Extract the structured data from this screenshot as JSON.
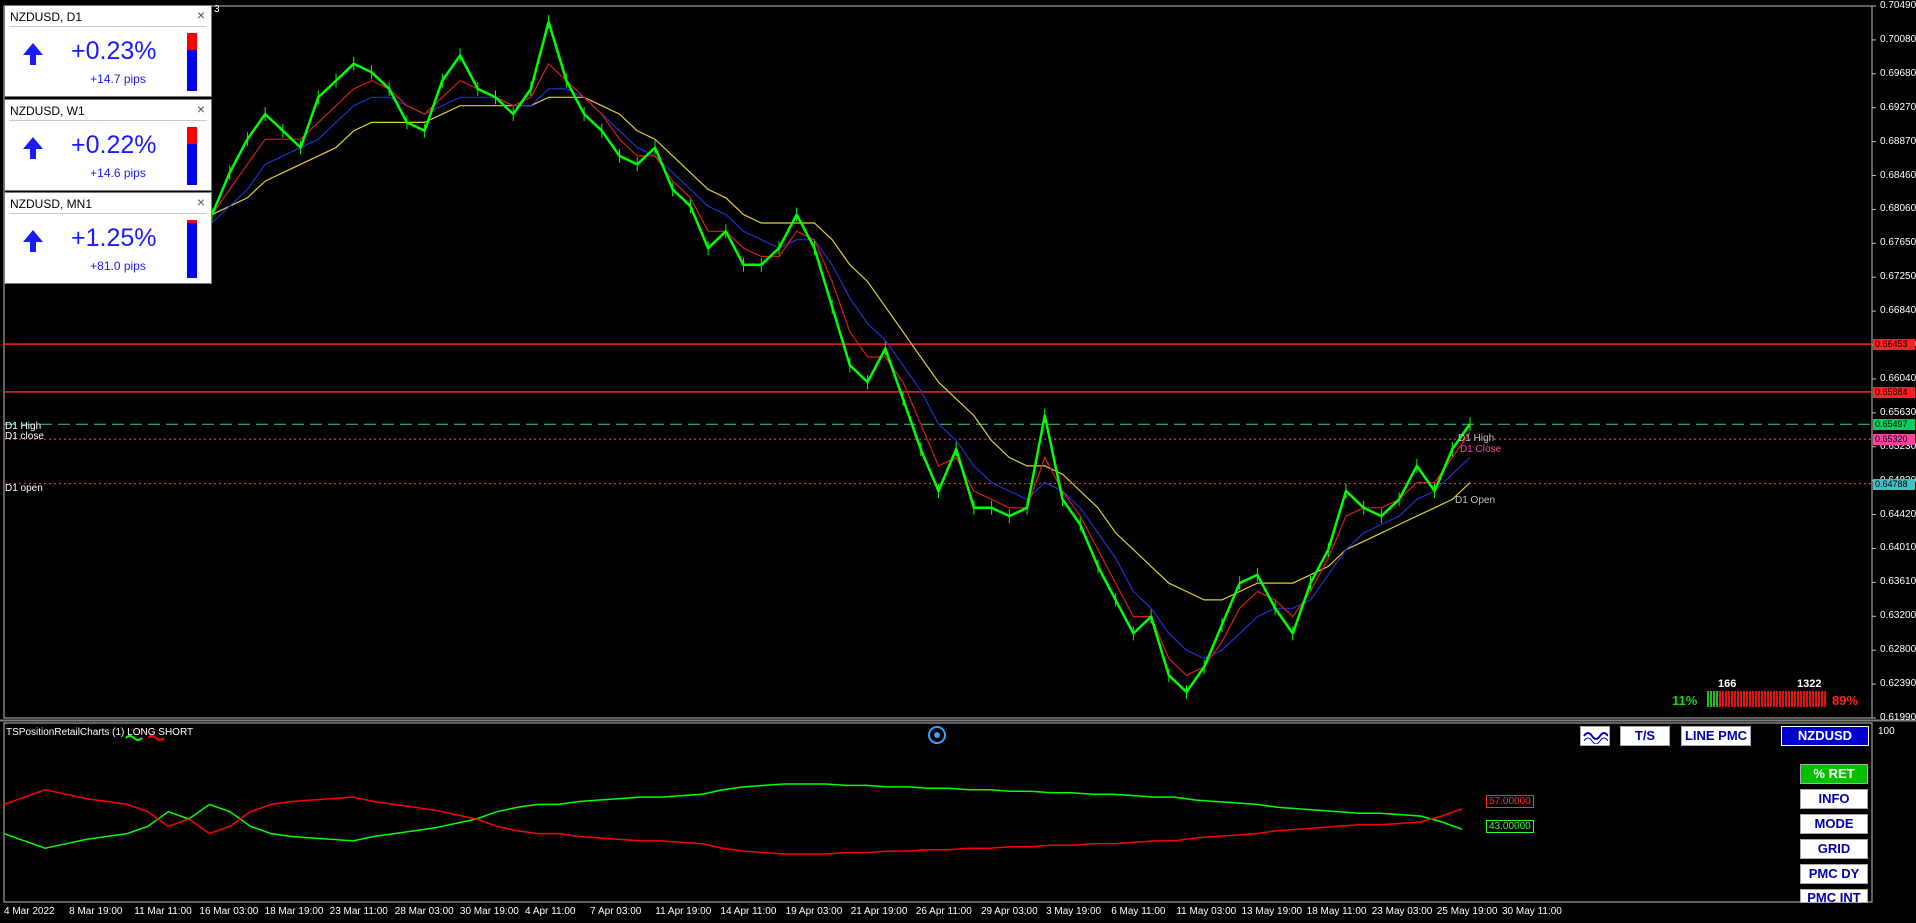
{
  "tickers": [
    {
      "title": "NZDUSD, D1",
      "change": "+0.23%",
      "pips": "+14.7 pips",
      "close": "×",
      "up_frac": 0.3
    },
    {
      "title": "NZDUSD, W1",
      "change": "+0.22%",
      "pips": "+14.6 pips",
      "close": "×",
      "up_frac": 0.3
    },
    {
      "title": "NZDUSD, MN1",
      "change": "+1.25%",
      "pips": "+81.0 pips",
      "close": "×",
      "up_frac": 0.05
    }
  ],
  "top_corner_label": "3",
  "y_axis": [
    "0.70490",
    "0.70080",
    "0.69680",
    "0.69270",
    "0.68870",
    "0.68460",
    "0.68060",
    "0.67650",
    "0.67250",
    "0.66840",
    "0.66440",
    "0.66040",
    "0.65630",
    "0.65230",
    "0.64830",
    "0.64420",
    "0.64010",
    "0.63610",
    "0.63200",
    "0.62800",
    "0.62390",
    "0.61990"
  ],
  "price_tags": [
    {
      "value": "0.66453",
      "color": "#ff2020"
    },
    {
      "value": "0.65884",
      "color": "#ff2020"
    },
    {
      "value": "0.65497",
      "color": "#00d060"
    },
    {
      "value": "0.65320",
      "color": "#ff40a0"
    },
    {
      "value": "0.64788",
      "color": "#40c0c0"
    }
  ],
  "left_labels": {
    "d1_high": "D1 High",
    "d1_close": "D1 close",
    "d1_open": "D1 open"
  },
  "right_labels": {
    "d1_high": "D1 High",
    "d1_close": "D1 Close",
    "d1_open": "D1 Open"
  },
  "sentiment": {
    "long_count": "166",
    "short_count": "1322",
    "long_pct": "11%",
    "short_pct": "89%",
    "long_frac": 0.11
  },
  "indicator": {
    "name": "TSPositionRetailCharts (1) LONG SHORT",
    "scale_top": "100",
    "short_value": "57.00000",
    "long_value": "43.00000",
    "colors": {
      "long": "#00ff00",
      "short": "#ff0000"
    }
  },
  "top_buttons": {
    "wave_icon": "wave-icon",
    "ts": "T/S",
    "line_pmc": "LINE PMC",
    "symbol": "NZDUSD"
  },
  "side_buttons": [
    "% RET",
    "INFO",
    "MODE",
    "GRID",
    "PMC DY",
    "PMC INT"
  ],
  "x_axis": [
    "4 Mar 2022",
    "8 Mar 19:00",
    "11 Mar 11:00",
    "16 Mar 03:00",
    "18 Mar 19:00",
    "23 Mar 11:00",
    "28 Mar 03:00",
    "30 Mar 19:00",
    "4 Apr 11:00",
    "7 Apr 03:00",
    "11 Apr 19:00",
    "14 Apr 11:00",
    "19 Apr 03:00",
    "21 Apr 19:00",
    "26 Apr 11:00",
    "29 Apr 03:00",
    "3 May 19:00",
    "6 May 11:00",
    "11 May 03:00",
    "13 May 19:00",
    "18 May 11:00",
    "23 May 03:00",
    "25 May 19:00",
    "30 May 11:00"
  ],
  "chart_data": {
    "type": "line",
    "symbol": "NZDUSD",
    "ylim": [
      0.6199,
      0.7049
    ],
    "price": [
      0.68,
      0.685,
      0.689,
      0.692,
      0.69,
      0.688,
      0.694,
      0.696,
      0.698,
      0.697,
      0.695,
      0.691,
      0.69,
      0.696,
      0.699,
      0.695,
      0.694,
      0.692,
      0.695,
      0.703,
      0.696,
      0.692,
      0.69,
      0.687,
      0.686,
      0.688,
      0.683,
      0.681,
      0.676,
      0.678,
      0.674,
      0.674,
      0.676,
      0.68,
      0.676,
      0.669,
      0.662,
      0.66,
      0.664,
      0.658,
      0.652,
      0.647,
      0.652,
      0.645,
      0.645,
      0.644,
      0.645,
      0.656,
      0.646,
      0.643,
      0.638,
      0.634,
      0.63,
      0.632,
      0.625,
      0.623,
      0.626,
      0.631,
      0.636,
      0.637,
      0.633,
      0.63,
      0.636,
      0.64,
      0.647,
      0.645,
      0.644,
      0.646,
      0.65,
      0.647,
      0.652,
      0.655
    ],
    "ma_fast": [
      0.68,
      0.683,
      0.686,
      0.689,
      0.689,
      0.689,
      0.691,
      0.693,
      0.695,
      0.696,
      0.695,
      0.693,
      0.692,
      0.694,
      0.696,
      0.695,
      0.694,
      0.693,
      0.694,
      0.698,
      0.696,
      0.694,
      0.692,
      0.689,
      0.687,
      0.687,
      0.684,
      0.682,
      0.678,
      0.678,
      0.676,
      0.675,
      0.675,
      0.678,
      0.677,
      0.672,
      0.666,
      0.663,
      0.663,
      0.66,
      0.655,
      0.65,
      0.651,
      0.647,
      0.646,
      0.645,
      0.645,
      0.651,
      0.647,
      0.644,
      0.64,
      0.636,
      0.632,
      0.632,
      0.627,
      0.625,
      0.626,
      0.629,
      0.633,
      0.635,
      0.634,
      0.632,
      0.635,
      0.639,
      0.644,
      0.645,
      0.645,
      0.646,
      0.648,
      0.648,
      0.651,
      0.654
    ],
    "ma_mid": [
      0.679,
      0.681,
      0.683,
      0.686,
      0.687,
      0.688,
      0.689,
      0.691,
      0.693,
      0.694,
      0.694,
      0.693,
      0.692,
      0.693,
      0.694,
      0.694,
      0.694,
      0.693,
      0.693,
      0.695,
      0.695,
      0.694,
      0.692,
      0.69,
      0.688,
      0.687,
      0.685,
      0.683,
      0.681,
      0.68,
      0.678,
      0.677,
      0.676,
      0.677,
      0.677,
      0.674,
      0.67,
      0.667,
      0.665,
      0.662,
      0.659,
      0.655,
      0.653,
      0.65,
      0.648,
      0.647,
      0.646,
      0.648,
      0.647,
      0.645,
      0.642,
      0.639,
      0.635,
      0.633,
      0.63,
      0.628,
      0.627,
      0.628,
      0.63,
      0.632,
      0.633,
      0.633,
      0.634,
      0.637,
      0.64,
      0.642,
      0.643,
      0.644,
      0.646,
      0.647,
      0.649,
      0.651
    ],
    "ma_slow": [
      0.68,
      0.681,
      0.682,
      0.684,
      0.685,
      0.686,
      0.687,
      0.688,
      0.69,
      0.691,
      0.691,
      0.691,
      0.691,
      0.692,
      0.693,
      0.693,
      0.693,
      0.693,
      0.693,
      0.694,
      0.694,
      0.694,
      0.693,
      0.692,
      0.69,
      0.689,
      0.687,
      0.685,
      0.683,
      0.682,
      0.68,
      0.679,
      0.679,
      0.679,
      0.679,
      0.677,
      0.674,
      0.672,
      0.669,
      0.666,
      0.663,
      0.66,
      0.658,
      0.656,
      0.653,
      0.651,
      0.65,
      0.65,
      0.649,
      0.647,
      0.645,
      0.642,
      0.64,
      0.638,
      0.636,
      0.635,
      0.634,
      0.634,
      0.635,
      0.636,
      0.636,
      0.636,
      0.637,
      0.638,
      0.64,
      0.641,
      0.642,
      0.643,
      0.644,
      0.645,
      0.646,
      0.648
    ],
    "levels": [
      {
        "value": 0.66453,
        "color": "#ff2020",
        "style": "solid"
      },
      {
        "value": 0.65884,
        "color": "#ff2020",
        "style": "solid"
      },
      {
        "value": 0.65497,
        "color": "#40d080",
        "style": "dashed"
      },
      {
        "value": 0.6532,
        "color": "#ff40a0",
        "style": "dotted"
      },
      {
        "value": 0.64788,
        "color": "#ff4040",
        "style": "dotted"
      }
    ],
    "long_pct": [
      40,
      35,
      30,
      33,
      36,
      38,
      40,
      45,
      55,
      50,
      60,
      55,
      45,
      40,
      38,
      37,
      36,
      35,
      38,
      40,
      42,
      44,
      47,
      50,
      55,
      58,
      60,
      60,
      62,
      63,
      64,
      65,
      65,
      66,
      67,
      70,
      72,
      73,
      74,
      74,
      74,
      73,
      73,
      72,
      72,
      71,
      71,
      70,
      70,
      69,
      69,
      68,
      68,
      67,
      67,
      66,
      65,
      65,
      63,
      62,
      61,
      60,
      58,
      57,
      56,
      55,
      54,
      54,
      53,
      52,
      48,
      43
    ],
    "short_pct": [
      60,
      65,
      70,
      67,
      64,
      62,
      60,
      55,
      45,
      50,
      40,
      45,
      55,
      60,
      62,
      63,
      64,
      65,
      62,
      60,
      58,
      56,
      53,
      50,
      45,
      42,
      40,
      40,
      38,
      37,
      36,
      35,
      35,
      34,
      33,
      30,
      28,
      27,
      26,
      26,
      26,
      27,
      27,
      28,
      28,
      29,
      29,
      30,
      30,
      31,
      31,
      32,
      32,
      33,
      33,
      34,
      35,
      35,
      37,
      38,
      39,
      40,
      42,
      43,
      44,
      45,
      46,
      46,
      47,
      48,
      52,
      57
    ]
  }
}
